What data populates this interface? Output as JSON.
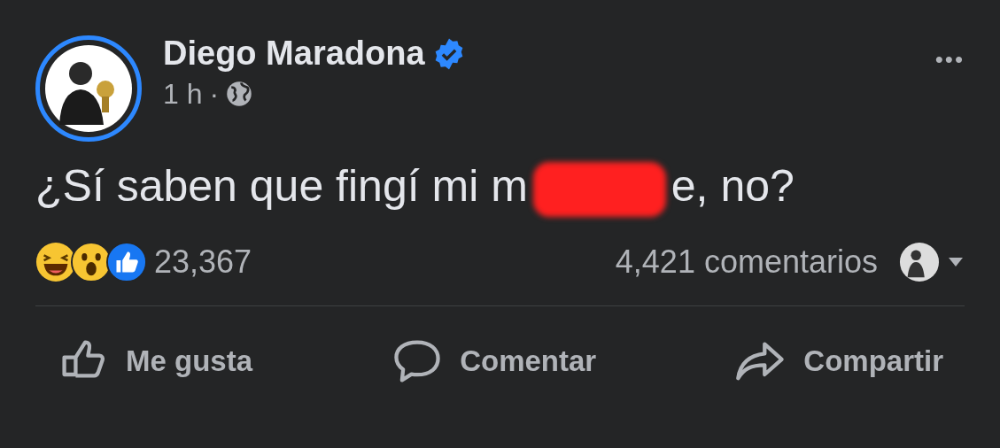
{
  "post": {
    "author": "Diego Maradona",
    "verified": true,
    "time": "1 h",
    "separator": "·",
    "text_parts": [
      {
        "kind": "text",
        "text": "¿Sí saben que fingí mi m"
      },
      {
        "kind": "redaction"
      },
      {
        "kind": "text",
        "text": "e, no?"
      }
    ],
    "reaction_count": "23,367",
    "comment_count": "4,421 comentarios",
    "more": "•••"
  },
  "actions": [
    {
      "kind": "like",
      "label": "Me gusta"
    },
    {
      "kind": "comment",
      "label": "Comentar"
    },
    {
      "kind": "share",
      "label": "Compartir"
    }
  ]
}
